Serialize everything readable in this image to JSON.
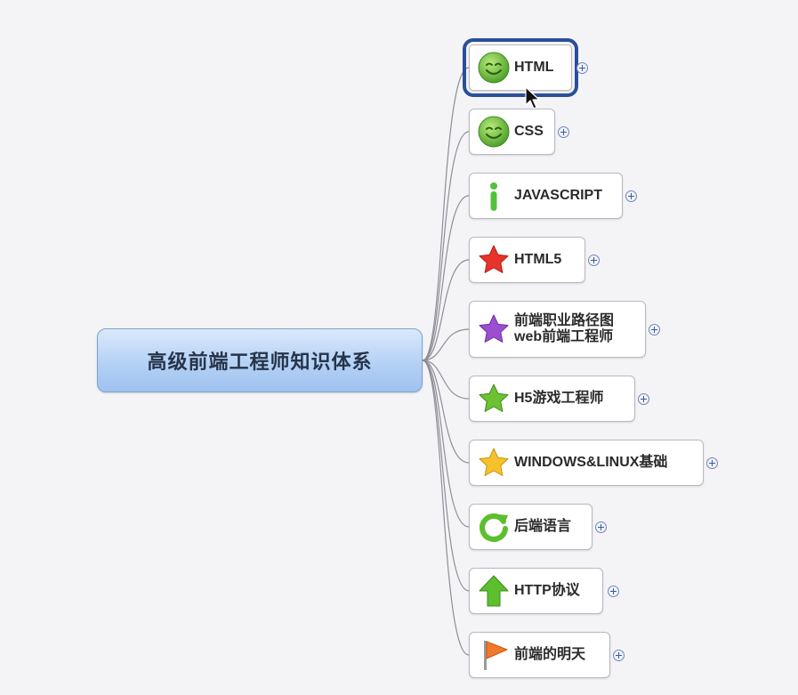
{
  "root": {
    "label": "高级前端工程师知识体系"
  },
  "topics": [
    {
      "label": "HTML",
      "icon": "smiley-icon",
      "selected": true
    },
    {
      "label": "CSS",
      "icon": "smiley-icon"
    },
    {
      "label": "JAVASCRIPT",
      "icon": "info-icon"
    },
    {
      "label": "HTML5",
      "icon": "red-star-icon"
    },
    {
      "label_lines": [
        "前端职业路径图",
        "web前端工程师"
      ],
      "icon": "purple-star-icon"
    },
    {
      "label": "H5游戏工程师",
      "icon": "green-star-icon"
    },
    {
      "label": "WINDOWS&LINUX基础",
      "icon": "yellow-star-icon"
    },
    {
      "label": "后端语言",
      "icon": "refresh-icon"
    },
    {
      "label": "HTTP协议",
      "icon": "up-arrow-icon"
    },
    {
      "label": "前端的明天",
      "icon": "flag-icon"
    }
  ],
  "colors": {
    "root_fill": "#b4d1f5",
    "selection_border": "#2a4f9a",
    "connector": "#8e8e96",
    "smiley": "#7cc243",
    "red_star": "#e8322a",
    "purple_star": "#9b4fd0",
    "green_star": "#6cc234",
    "yellow_star": "#f6c12a",
    "flag": "#f07a2a"
  }
}
